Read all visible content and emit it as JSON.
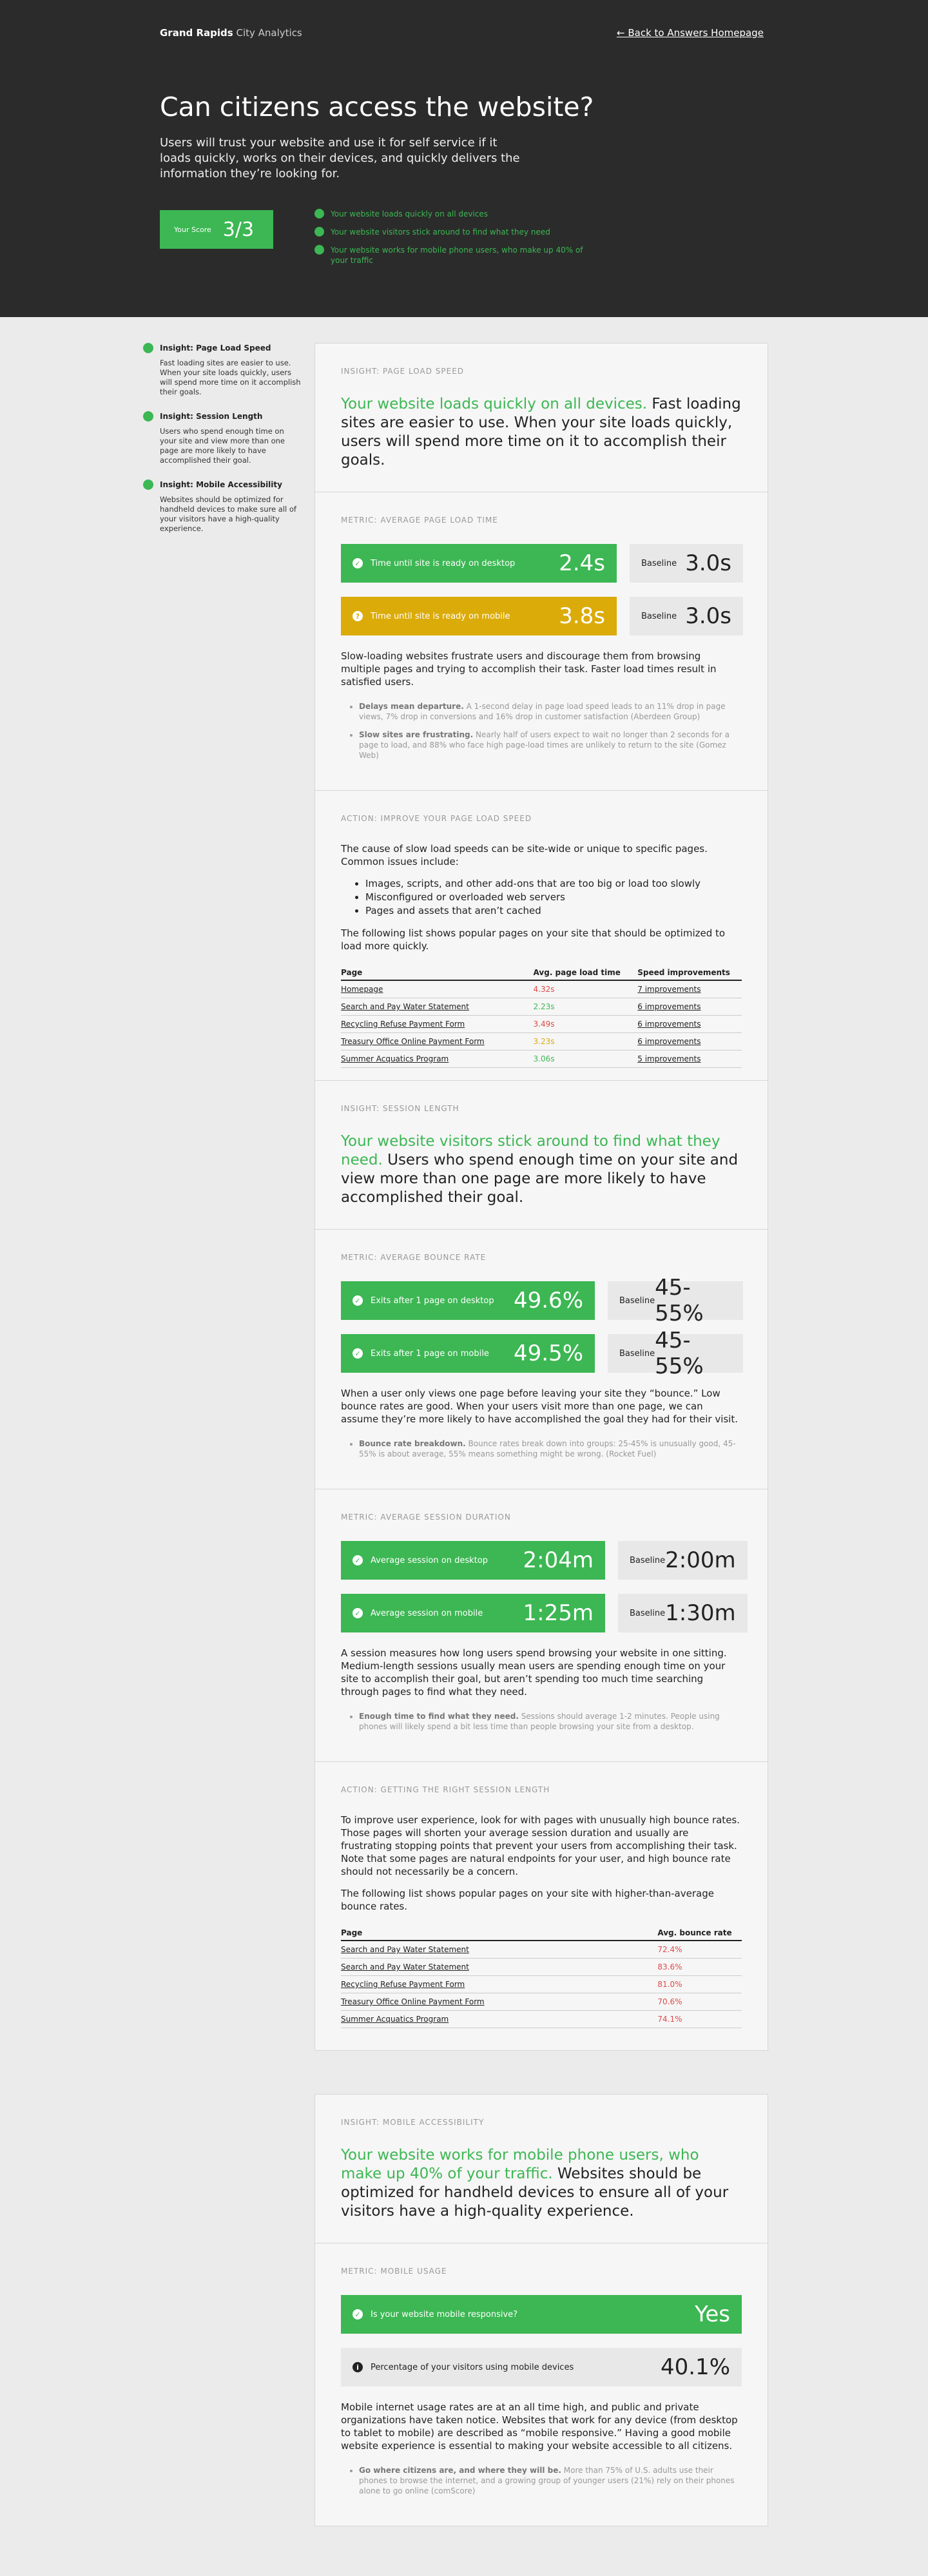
{
  "brand": {
    "bold": "Grand Rapids",
    "rest": "City Analytics"
  },
  "back_link": "← Back to Answers Homepage",
  "hero": {
    "title": "Can citizens access the website?",
    "lede": "Users will trust your website and use it for self service if it loads quickly, works on their devices, and quickly delivers the information they’re looking for.",
    "score_label": "Your Score",
    "score_value": "3/3",
    "checks": [
      "Your website loads quickly on all devices",
      "Your website visitors stick around to find what they need",
      "Your website works for mobile phone users, who make up 40% of your traffic"
    ]
  },
  "sidebar": [
    {
      "title": "Insight: Page Load Speed",
      "body": "Fast loading sites are easier to use. When your site loads quickly, users will spend more time on it accomplish their goals."
    },
    {
      "title": "Insight: Session Length",
      "body": "Users who spend enough time on your site and view more than one page are more likely to have accomplished their goal."
    },
    {
      "title": "Insight: Mobile Accessibility",
      "body": "Websites should be optimized for handheld devices to make sure all of your visitors have a high-quality experience."
    }
  ],
  "speed": {
    "kicker": "Insight: Page Load Speed",
    "green": "Your website loads quickly on all devices.",
    "rest": " Fast loading sites are easier to use. When your site loads quickly, users will spend more time on it to accomplish their goals.",
    "metric_kicker": "Metric: Average Page Load Time",
    "rows": [
      {
        "label": "Time until site is ready on desktop",
        "value": "2.4s",
        "baseline_label": "Baseline",
        "baseline": "3.0s",
        "color": "#3cb753",
        "icon": "✓"
      },
      {
        "label": "Time until site is ready on mobile",
        "value": "3.8s",
        "baseline_label": "Baseline",
        "baseline": "3.0s",
        "color": "#dbab09",
        "icon": "?"
      }
    ],
    "para": "Slow-loading websites frustrate users and discourage them from browsing multiple pages and trying to accomplish their task. Faster load times result in satisfied users.",
    "notes": [
      {
        "b": "Delays mean departure.",
        "t": " A 1-second delay in page load speed leads to an 11% drop in page views, 7% drop in conversions and 16% drop in customer satisfaction (Aberdeen Group)"
      },
      {
        "b": "Slow sites are frustrating.",
        "t": " Nearly half of users expect to wait no longer than 2 seconds for a page to load, and 88% who face high page-load times are unlikely to return to the site (Gomez Web)"
      }
    ],
    "action_kicker": "Action: Improve your page load speed",
    "action_para1": "The cause of slow load speeds can be site-wide or unique to specific pages. Common issues include:",
    "bullets": [
      "Images, scripts, and other add-ons that are too big or load too slowly",
      "Misconfigured or overloaded web servers",
      "Pages and assets that aren’t cached"
    ],
    "action_para2": "The following list shows popular pages on your site that should be optimized to load more quickly.",
    "table_headers": [
      "Page",
      "Avg. page load time",
      "Speed improvements"
    ],
    "table": [
      {
        "page": "Homepage",
        "time": "4.32s",
        "color": "#e04848",
        "imp": "7 improvements"
      },
      {
        "page": "Search and Pay Water Statement",
        "time": "2.23s",
        "color": "#3cb753",
        "imp": "6 improvements"
      },
      {
        "page": "Recycling Refuse Payment Form",
        "time": "3.49s",
        "color": "#e04848",
        "imp": "6 improvements"
      },
      {
        "page": "Treasury Office Online Payment Form",
        "time": "3.23s",
        "color": "#dbab09",
        "imp": "6 improvements"
      },
      {
        "page": "Summer Acquatics Program",
        "time": "3.06s",
        "color": "#3cb753",
        "imp": "5 improvements"
      }
    ]
  },
  "session": {
    "kicker": "Insight: Session Length",
    "green": "Your website visitors stick around to find what they need.",
    "rest": " Users who spend enough time on your site and view more than one page are more likely to have accomplished their goal.",
    "bounce_kicker": "Metric: Average Bounce Rate",
    "bounce_rows": [
      {
        "label": "Exits after 1 page on desktop",
        "value": "49.6%",
        "baseline_label": "Baseline",
        "baseline": "45-55%"
      },
      {
        "label": "Exits after 1 page on mobile",
        "value": "49.5%",
        "baseline_label": "Baseline",
        "baseline": "45-55%"
      }
    ],
    "bounce_para": "When a user only views one page before leaving your site they “bounce.” Low bounce rates are good. When your users visit more than one page, we can assume they’re more likely to have accomplished the goal they had for their visit.",
    "bounce_note": {
      "b": "Bounce rate breakdown.",
      "t": " Bounce rates break down into groups: 25-45% is unusually good, 45-55% is about average, 55% means something might be wrong. (Rocket Fuel)"
    },
    "duration_kicker": "Metric: Average Session Duration",
    "duration_rows": [
      {
        "label": "Average session on desktop",
        "value": "2:04m",
        "baseline_label": "Baseline",
        "baseline": "2:00m"
      },
      {
        "label": "Average session on mobile",
        "value": "1:25m",
        "baseline_label": "Baseline",
        "baseline": "1:30m"
      }
    ],
    "duration_para": "A session measures how long users spend browsing your website in one sitting. Medium-length sessions usually mean users are spending enough time on your site to accomplish their goal, but aren’t spending too much time searching through pages to find what they need.",
    "duration_note": {
      "b": "Enough time to find what they need.",
      "t": " Sessions should average 1-2 minutes. People using phones will likely spend a bit less time than people browsing your site from a desktop."
    },
    "action_kicker": "Action: Getting the right session length",
    "action_para1": "To improve user experience, look for with pages with unusually high bounce rates. Those pages will shorten your average session duration and usually are frustrating stopping points that prevent your users from accomplishing their task. Note that some pages are natural endpoints for your user, and high bounce rate should not necessarily be a concern.",
    "action_para2": "The following list shows popular pages on your site with higher-than-average bounce rates.",
    "table_headers": [
      "Page",
      "Avg. bounce rate"
    ],
    "table": [
      {
        "page": "Search and Pay Water Statement",
        "rate": "72.4%"
      },
      {
        "page": "Search and Pay Water Statement",
        "rate": "83.6%"
      },
      {
        "page": "Recycling Refuse Payment Form",
        "rate": "81.0%"
      },
      {
        "page": "Treasury Office Online Payment Form",
        "rate": "70.6%"
      },
      {
        "page": "Summer Acquatics Program",
        "rate": "74.1%"
      }
    ]
  },
  "mobile": {
    "kicker": "Insight: Mobile Accessibility",
    "green": "Your website works for mobile phone users, who make up 40% of your traffic.",
    "rest": " Websites should be optimized for handheld devices to ensure all of your visitors have a high-quality experience.",
    "metric_kicker": "Metric: Mobile Usage",
    "responsive_label": "Is your website mobile responsive?",
    "responsive_value": "Yes",
    "share_label": "Percentage of your visitors using mobile devices",
    "share_value": "40.1%",
    "para": "Mobile internet usage rates are at an all time high, and public and private organizations have taken notice. Websites that work for any device (from desktop to tablet to mobile) are described as “mobile responsive.” Having a good mobile website experience is essential to making your website accessible to all citizens.",
    "note": {
      "b": "Go where citizens are, and where they will be.",
      "t": " More than 75% of U.S. adults use their phones to browse the internet, and a growing group of younger users (21%) rely on their phones alone to go online (comScore)"
    }
  },
  "colors": {
    "green": "#3cb753",
    "yellow": "#dbab09",
    "red": "#e04848",
    "dark": "#2b2b2b"
  }
}
